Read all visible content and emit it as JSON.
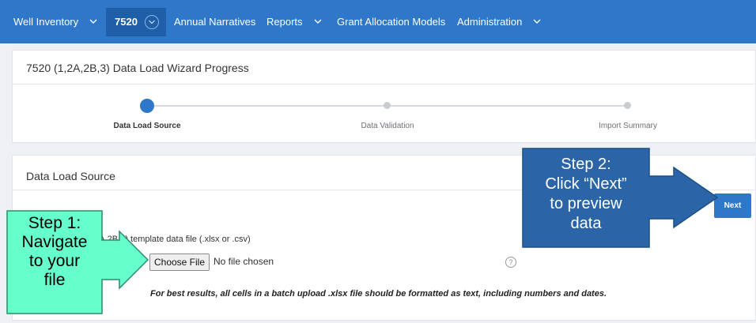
{
  "nav": {
    "items": [
      {
        "label": "Well Inventory",
        "has_caret": true
      },
      {
        "label": "7520",
        "active": true
      },
      {
        "label": "Annual Narratives"
      },
      {
        "label": "Reports",
        "has_caret": true
      },
      {
        "label": "Grant Allocation Models"
      },
      {
        "label": "Administration",
        "has_caret": true
      }
    ],
    "colors": {
      "bar": "#2e77c9",
      "active": "#1f5fa8"
    }
  },
  "wizard": {
    "title": "7520 (1,2A,2B,3) Data Load Wizard Progress",
    "steps": [
      {
        "label": "Data Load Source",
        "state": "current"
      },
      {
        "label": "Data Validation",
        "state": "pending"
      },
      {
        "label": "Import Summary",
        "state": "pending"
      }
    ]
  },
  "form": {
    "title": "Data Load Source",
    "next_label": "Next",
    "field_label_visible": "1,2A,2B,3) template data file (.xlsx or .csv)",
    "choose_file_label": "Choose File",
    "no_file_text": "No file chosen",
    "help_icon": "question-circle-icon",
    "note": "For best results, all cells in a batch upload .xlsx file should be formatted as text, including numbers and dates."
  },
  "callouts": {
    "step1": {
      "lines": [
        "Step 1:",
        "Navigate",
        "to your",
        "file"
      ],
      "fill": "#66ffcc",
      "border": "#2a8a6a"
    },
    "step2": {
      "lines": [
        "Step 2:",
        "Click “Next”",
        "to preview",
        "data"
      ],
      "fill": "#2b65a8",
      "arrow_fill": "#2e6fb8",
      "border": "#1c4f86"
    }
  }
}
